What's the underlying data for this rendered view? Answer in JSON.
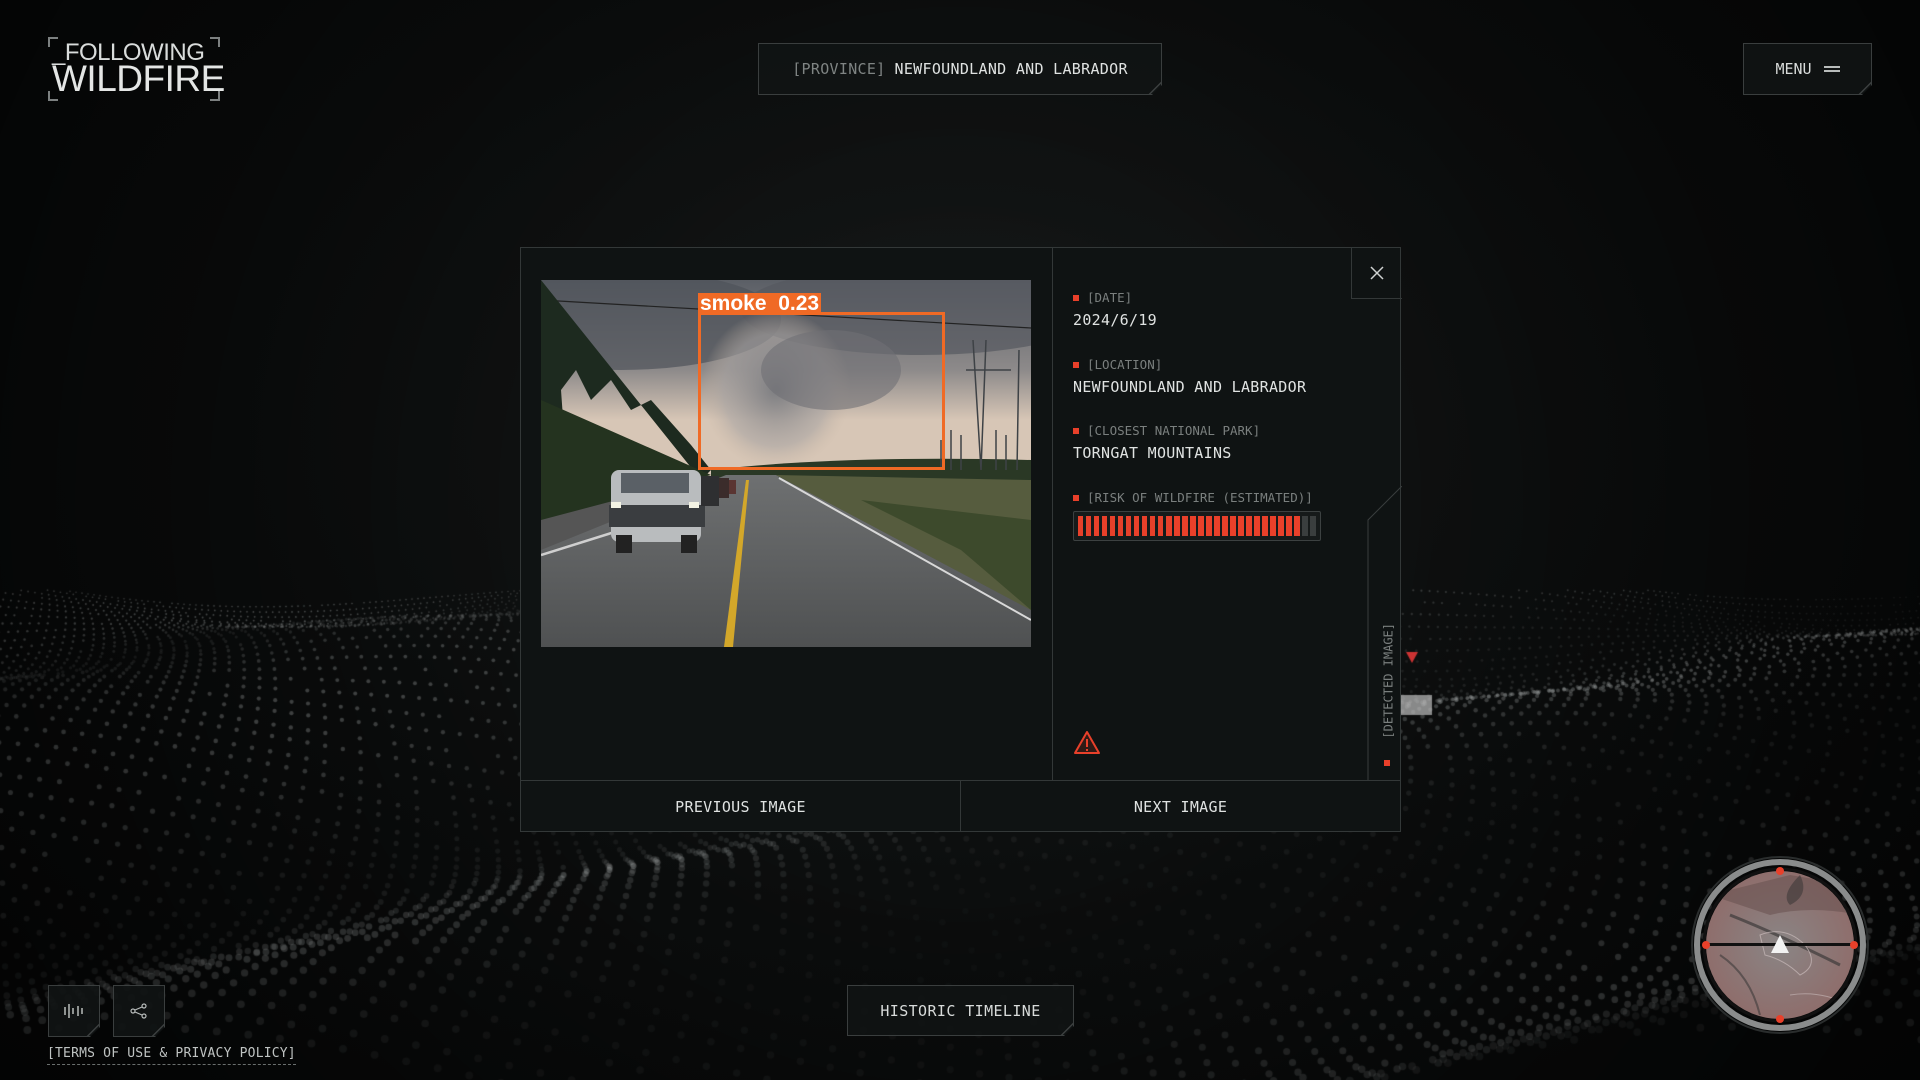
{
  "header": {
    "logo_line1": "_FOLLOWING",
    "logo_line2": "WILDFIRE",
    "province_tag": "[PROVINCE]",
    "province_value": "NEWFOUNDLAND AND LABRADOR",
    "menu_label": "MENU"
  },
  "modal": {
    "detection": {
      "label": "smoke",
      "confidence": "0.23",
      "box_color": "#f06a25"
    },
    "fields": [
      {
        "label": "[DATE]",
        "value": "2024/6/19"
      },
      {
        "label": "[LOCATION]",
        "value": "NEWFOUNDLAND AND LABRADOR"
      },
      {
        "label": "[CLOSEST NATIONAL PARK]",
        "value": "TORNGAT MOUNTAINS"
      }
    ],
    "risk": {
      "label": "[RISK OF WILDFIRE (ESTIMATED)]",
      "filled_segments": 28,
      "total_segments": 30
    },
    "side_label": "[DETECTED IMAGE]",
    "prev_label": "PREVIOUS IMAGE",
    "next_label": "NEXT IMAGE",
    "icons": {
      "close": "close-icon",
      "warning": "warning-icon"
    }
  },
  "footer": {
    "historic_label": "HISTORIC TIMELINE",
    "terms_label": "[TERMS OF USE & PRIVACY POLICY]",
    "icons": [
      "sound-wave-icon",
      "share-icon"
    ]
  },
  "colors": {
    "accent_red": "#e8402a",
    "background": "#0d0f0f",
    "border": "#3a3e3e"
  }
}
